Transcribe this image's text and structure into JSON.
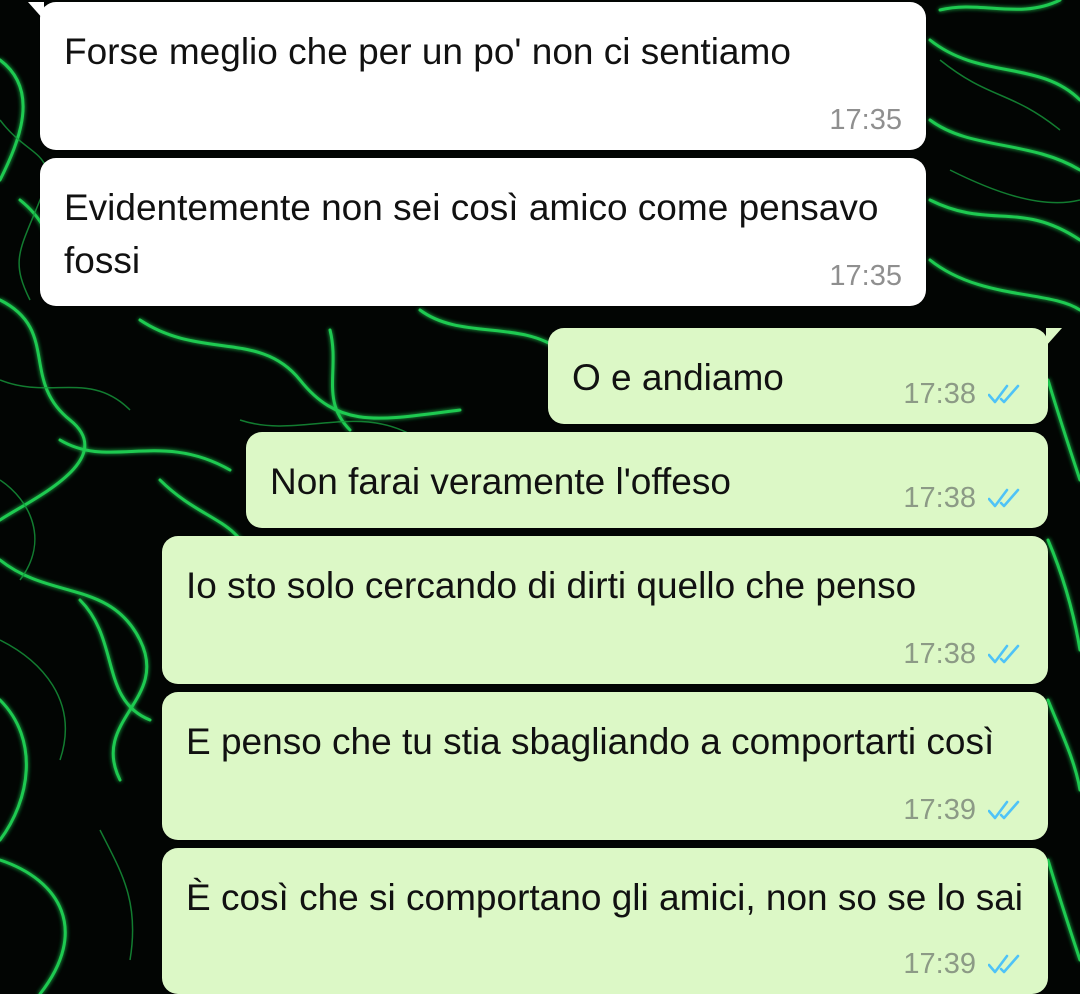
{
  "colors": {
    "incoming_bubble": "#ffffff",
    "outgoing_bubble": "#dcf8c6",
    "read_ticks": "#4fc3f7",
    "wallpaper_glow": "#22e05a",
    "wallpaper_base": "#020503"
  },
  "messages": [
    {
      "direction": "incoming",
      "text": "Forse meglio che per un po' non ci sentiamo",
      "time": "17:35"
    },
    {
      "direction": "incoming",
      "text": "Evidentemente non sei così amico come pensavo fossi",
      "time": "17:35"
    },
    {
      "direction": "outgoing",
      "text": "O e andiamo",
      "time": "17:38",
      "status_icon": "double-check-read-icon"
    },
    {
      "direction": "outgoing",
      "text": "Non farai veramente l'offeso",
      "time": "17:38",
      "status_icon": "double-check-read-icon"
    },
    {
      "direction": "outgoing",
      "text": "Io sto solo cercando di dirti quello che penso",
      "time": "17:38",
      "status_icon": "double-check-read-icon"
    },
    {
      "direction": "outgoing",
      "text": "E penso che tu stia sbagliando a comportarti così",
      "time": "17:39",
      "status_icon": "double-check-read-icon"
    },
    {
      "direction": "outgoing",
      "text": "È così che si comportano gli amici, non so se lo sai",
      "time": "17:39",
      "status_icon": "double-check-read-icon"
    }
  ]
}
